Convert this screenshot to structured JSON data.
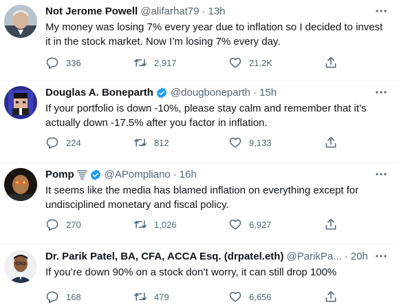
{
  "tweets": [
    {
      "name": "Not Jerome Powell",
      "handle": "@alifarhat79",
      "time": "13h",
      "text": "My money was losing 7% every year due to inflation so I decided to invest it in the stock market. Now I’m losing 7% every day.",
      "replies": "336",
      "retweets": "2,917",
      "likes": "21.2K"
    },
    {
      "name": "Douglas A. Boneparth",
      "handle": "@dougboneparth",
      "time": "15h",
      "verified": true,
      "text": "If your portfolio is down -10%, please stay calm and remember that it’s actually down -17.5% after you factor in inflation.",
      "replies": "224",
      "retweets": "812",
      "likes": "9,133"
    },
    {
      "name": "Pomp",
      "handle": "@APompliano",
      "time": "16h",
      "verified": true,
      "text": "It seems like the media has blamed inflation on everything except for undisciplined monetary and fiscal policy.",
      "replies": "270",
      "retweets": "1,026",
      "likes": "6,927"
    },
    {
      "name": "Dr. Parik Patel, BA, CFA, ACCA Esq. (drpatel.eth)",
      "handle": "@ParikPa...",
      "time": "20h",
      "text": "If you’re down 90% on a stock don’t worry, it can still drop 100%",
      "replies": "168",
      "retweets": "479",
      "likes": "6,656"
    }
  ],
  "dot": "·",
  "colors": {
    "verified": "#1d9bf0",
    "muted": "#536471",
    "text": "#0f1419",
    "divider": "#eff3f4"
  }
}
